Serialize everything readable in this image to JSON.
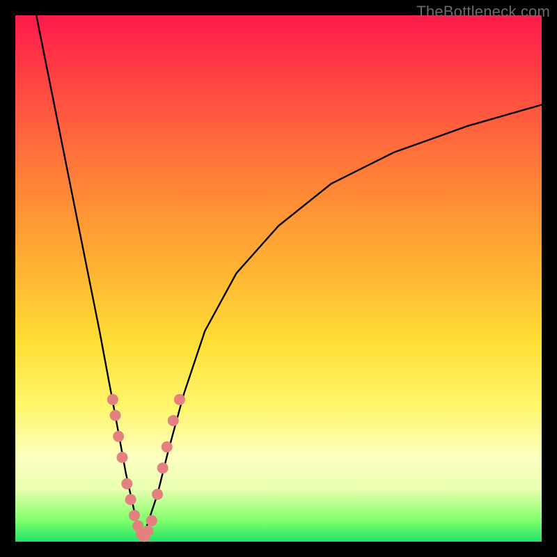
{
  "watermark": "TheBottleneck.com",
  "colors": {
    "frame": "#000000",
    "curve": "#000000",
    "marker": "#e58080",
    "gradient_stops": [
      "#ff1a4b",
      "#ff3545",
      "#ff5d3f",
      "#ff8a36",
      "#ffb233",
      "#ffde35",
      "#fff66a",
      "#fdffc0",
      "#e8ffb0",
      "#7fff6a",
      "#21e36a"
    ]
  },
  "chart_data": {
    "type": "line",
    "title": "",
    "xlabel": "",
    "ylabel": "",
    "xlim": [
      0,
      100
    ],
    "ylim": [
      0,
      100
    ],
    "curve": {
      "description": "V-shaped bottleneck curve with minimum near x≈24 reaching y≈0; left branch rises steeply to y≈100 at x≈4; right branch rises with decreasing slope to y≈83 at x=100.",
      "x": [
        4,
        8,
        12,
        16,
        19,
        21,
        23,
        24,
        25,
        27,
        29,
        32,
        36,
        42,
        50,
        60,
        72,
        86,
        100
      ],
      "y": [
        100,
        80,
        60,
        40,
        24,
        13,
        4,
        1,
        3,
        9,
        17,
        28,
        40,
        51,
        60,
        68,
        74,
        79,
        83
      ]
    },
    "markers": {
      "description": "Highlighted data points clustered near the valley of the curve (pale red dots).",
      "points": [
        {
          "x": 18.5,
          "y": 27
        },
        {
          "x": 19.0,
          "y": 24
        },
        {
          "x": 19.6,
          "y": 20
        },
        {
          "x": 20.3,
          "y": 16
        },
        {
          "x": 21.2,
          "y": 11
        },
        {
          "x": 21.9,
          "y": 8
        },
        {
          "x": 22.6,
          "y": 5
        },
        {
          "x": 23.3,
          "y": 3
        },
        {
          "x": 23.9,
          "y": 1.5
        },
        {
          "x": 24.5,
          "y": 1
        },
        {
          "x": 25.2,
          "y": 2
        },
        {
          "x": 25.9,
          "y": 4
        },
        {
          "x": 27.0,
          "y": 9
        },
        {
          "x": 28.0,
          "y": 14
        },
        {
          "x": 28.8,
          "y": 18
        },
        {
          "x": 30.0,
          "y": 23
        },
        {
          "x": 31.2,
          "y": 27
        }
      ]
    }
  }
}
